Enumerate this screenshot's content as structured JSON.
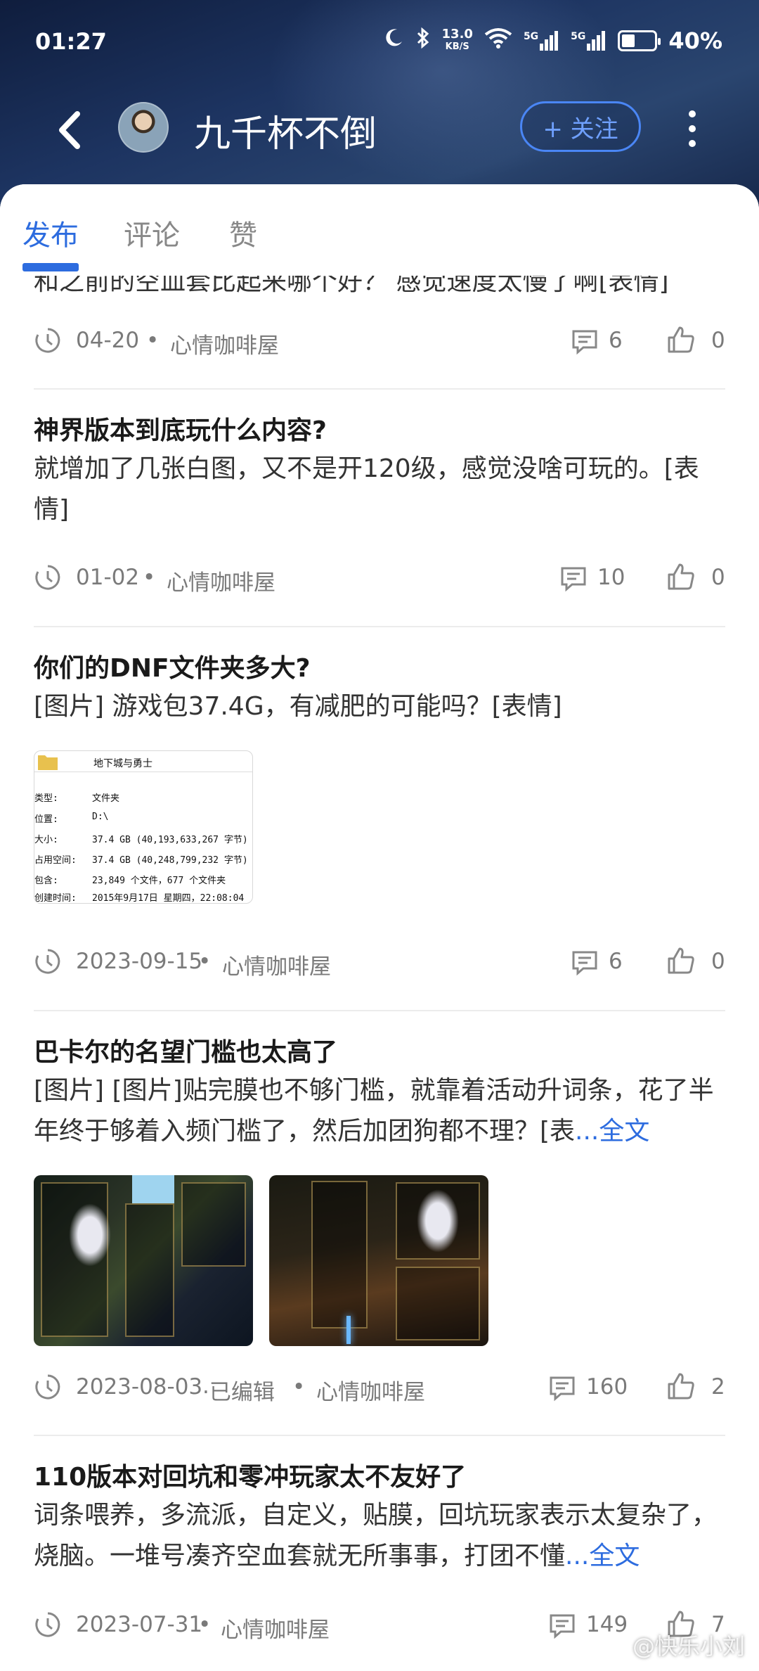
{
  "status_bar": {
    "time": "01:27",
    "net_speed_value": "13.0",
    "net_speed_unit": "KB/S",
    "signal1": "5G",
    "signal2": "5G",
    "battery": "40%",
    "battery_level": 0.4
  },
  "header": {
    "user_name": "九千杯不倒",
    "follow_label": "+ 关注"
  },
  "tabs": [
    {
      "label": "发布",
      "active": true
    },
    {
      "label": "评论",
      "active": false
    },
    {
      "label": "赞",
      "active": false
    }
  ],
  "posts": [
    {
      "title": "",
      "body": "和之前的空血套比起来哪个好？ 感觉速度太慢了啊[表情]",
      "date": "04-20",
      "edited": "",
      "forum": "心情咖啡屋",
      "comments": "6",
      "likes": "0"
    },
    {
      "title": "神界版本到底玩什么内容?",
      "body": "就增加了几张白图，又不是开120级，感觉没啥可玩的。[表情]",
      "date": "01-02",
      "edited": "",
      "forum": "心情咖啡屋",
      "comments": "10",
      "likes": "0"
    },
    {
      "title": "你们的DNF文件夹多大?",
      "body": "[图片]  游戏包37.4G，有减肥的可能吗？[表情]",
      "date": "2023-09-15",
      "edited": "",
      "forum": "心情咖啡屋",
      "comments": "6",
      "likes": "0",
      "folder_image": {
        "name": "地下城与勇士",
        "rows": [
          {
            "k": "类型:",
            "v": "文件夹"
          },
          {
            "k": "位置:",
            "v": "D:\\"
          },
          {
            "k": "大小:",
            "v": "37.4 GB (40,193,633,267 字节)"
          },
          {
            "k": "占用空间:",
            "v": "37.4 GB (40,248,799,232 字节)"
          },
          {
            "k": "包含:",
            "v": "23,849 个文件，677 个文件夹"
          },
          {
            "k": "创建时间:",
            "v": "2015年9月17日 星期四，22:08:04"
          }
        ]
      }
    },
    {
      "title": "巴卡尔的名望门槛也太高了",
      "body": " [图片] [图片]贴完膜也不够门槛，就靠着活动升词条，花了半年终于够着入频门槛了，然后加团狗都不理？[表",
      "read_more": "...全文",
      "date": "2023-08-03",
      "edited": "·已编辑",
      "forum": "心情咖啡屋",
      "comments": "160",
      "likes": "2"
    },
    {
      "title": "110版本对回坑和零冲玩家太不友好了",
      "body": "词条喂养，多流派，自定义，贴膜，回坑玩家表示太复杂了，烧脑。一堆号凑齐空血套就无所事事，打团不懂",
      "read_more": "...全文",
      "date": "2023-07-31",
      "edited": "",
      "forum": "心情咖啡屋",
      "comments": "149",
      "likes": "7"
    }
  ],
  "watermark": "@快乐小刘",
  "colors": {
    "accent": "#2d6cdf",
    "header_bg": "#1d3461",
    "meta_text": "#7a7a7a"
  }
}
